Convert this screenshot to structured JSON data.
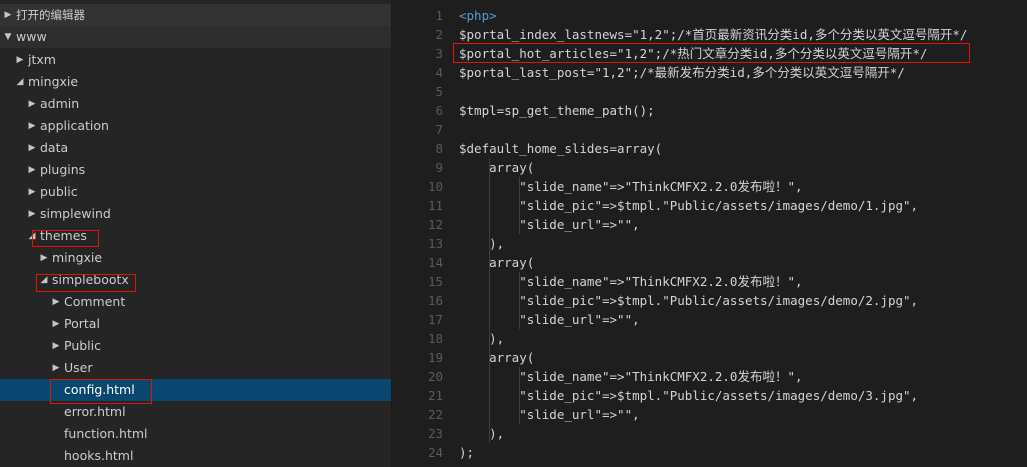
{
  "explorer": {
    "open_editors_label": "打开的编辑器",
    "root_label": "www",
    "items": [
      {
        "label": "jtxm",
        "state": "collapsed",
        "depth": 1
      },
      {
        "label": "mingxie",
        "state": "expanded",
        "depth": 1
      },
      {
        "label": "admin",
        "state": "collapsed",
        "depth": 2
      },
      {
        "label": "application",
        "state": "collapsed",
        "depth": 2
      },
      {
        "label": "data",
        "state": "collapsed",
        "depth": 2
      },
      {
        "label": "plugins",
        "state": "collapsed",
        "depth": 2
      },
      {
        "label": "public",
        "state": "collapsed",
        "depth": 2
      },
      {
        "label": "simplewind",
        "state": "collapsed",
        "depth": 2
      },
      {
        "label": "themes",
        "state": "expanded",
        "depth": 2
      },
      {
        "label": "mingxie",
        "state": "collapsed",
        "depth": 3
      },
      {
        "label": "simplebootx",
        "state": "expanded",
        "depth": 3
      },
      {
        "label": "Comment",
        "state": "collapsed",
        "depth": 4
      },
      {
        "label": "Portal",
        "state": "collapsed",
        "depth": 4
      },
      {
        "label": "Public",
        "state": "collapsed",
        "depth": 4
      },
      {
        "label": "User",
        "state": "collapsed",
        "depth": 4
      },
      {
        "label": "config.html",
        "state": "file",
        "depth": 4,
        "selected": true
      },
      {
        "label": "error.html",
        "state": "file",
        "depth": 4
      },
      {
        "label": "function.html",
        "state": "file",
        "depth": 4
      },
      {
        "label": "hooks.html",
        "state": "file",
        "depth": 4
      }
    ]
  },
  "editor": {
    "lines": [
      {
        "n": "1",
        "parts": [
          {
            "t": "<php>",
            "c": "tag"
          }
        ]
      },
      {
        "n": "2",
        "parts": [
          {
            "t": "$portal_index_lastnews=\"1,2\";/*首页最新资讯分类id,多个分类以英文逗号隔开*/",
            "c": "plain"
          }
        ]
      },
      {
        "n": "3",
        "parts": [
          {
            "t": "$portal_hot_articles",
            "c": "plain"
          },
          {
            "t": "=\"1,2\";/*热门文章分类id,多个分类以英文逗号隔开*/",
            "c": "plain"
          }
        ]
      },
      {
        "n": "4",
        "parts": [
          {
            "t": "$portal_last_post=\"1,2\";/*最新发布分类id,多个分类以英文逗号隔开*/",
            "c": "plain"
          }
        ]
      },
      {
        "n": "5",
        "parts": [
          {
            "t": "",
            "c": "plain"
          }
        ]
      },
      {
        "n": "6",
        "parts": [
          {
            "t": "$tmpl=sp_get_theme_path();",
            "c": "plain"
          }
        ]
      },
      {
        "n": "7",
        "parts": [
          {
            "t": "",
            "c": "plain"
          }
        ]
      },
      {
        "n": "8",
        "parts": [
          {
            "t": "$default_home_slides=array(",
            "c": "plain"
          }
        ]
      },
      {
        "n": "9",
        "parts": [
          {
            "t": "    array(",
            "c": "plain"
          }
        ]
      },
      {
        "n": "10",
        "parts": [
          {
            "t": "        \"slide_name\"=>\"ThinkCMFX2.2.0发布啦！\",",
            "c": "plain"
          }
        ]
      },
      {
        "n": "11",
        "parts": [
          {
            "t": "        \"slide_pic\"=>$tmpl.\"Public/assets/images/demo/1.jpg\",",
            "c": "plain"
          }
        ]
      },
      {
        "n": "12",
        "parts": [
          {
            "t": "        \"slide_url\"=>\"\",",
            "c": "plain"
          }
        ]
      },
      {
        "n": "13",
        "parts": [
          {
            "t": "    ),",
            "c": "plain"
          }
        ]
      },
      {
        "n": "14",
        "parts": [
          {
            "t": "    array(",
            "c": "plain"
          }
        ]
      },
      {
        "n": "15",
        "parts": [
          {
            "t": "        \"slide_name\"=>\"ThinkCMFX2.2.0发布啦！\",",
            "c": "plain"
          }
        ]
      },
      {
        "n": "16",
        "parts": [
          {
            "t": "        \"slide_pic\"=>$tmpl.\"Public/assets/images/demo/2.jpg\",",
            "c": "plain"
          }
        ]
      },
      {
        "n": "17",
        "parts": [
          {
            "t": "        \"slide_url\"=>\"\",",
            "c": "plain"
          }
        ]
      },
      {
        "n": "18",
        "parts": [
          {
            "t": "    ),",
            "c": "plain"
          }
        ]
      },
      {
        "n": "19",
        "parts": [
          {
            "t": "    array(",
            "c": "plain"
          }
        ]
      },
      {
        "n": "20",
        "parts": [
          {
            "t": "        \"slide_name\"=>\"ThinkCMFX2.2.0发布啦！\",",
            "c": "plain"
          }
        ]
      },
      {
        "n": "21",
        "parts": [
          {
            "t": "        \"slide_pic\"=>$tmpl.\"Public/assets/images/demo/3.jpg\",",
            "c": "plain"
          }
        ]
      },
      {
        "n": "22",
        "parts": [
          {
            "t": "        \"slide_url\"=>\"\",",
            "c": "plain"
          }
        ]
      },
      {
        "n": "23",
        "parts": [
          {
            "t": "    ),",
            "c": "plain"
          }
        ]
      },
      {
        "n": "24",
        "parts": [
          {
            "t": ");",
            "c": "plain"
          }
        ]
      }
    ]
  },
  "colors": {
    "tag": "#569cd6",
    "plain": "#d4d4d4",
    "highlight_box": "#e51400",
    "selection": "#094771"
  }
}
